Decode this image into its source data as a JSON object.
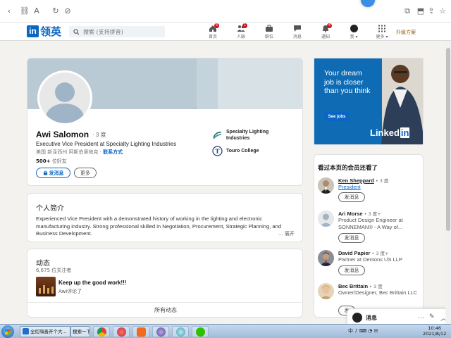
{
  "nav": {
    "logo": "领英",
    "search_placeholder": "搜索 (支持拼音)",
    "items": [
      {
        "label": "首页",
        "badge": "6"
      },
      {
        "label": "人脉",
        "badge": "1"
      },
      {
        "label": "职位",
        "badge": ""
      },
      {
        "label": "消息",
        "badge": ""
      },
      {
        "label": "通知",
        "badge": "4"
      },
      {
        "label": "我 ▾",
        "badge": ""
      },
      {
        "label": "更多 ▾",
        "badge": ""
      }
    ],
    "upgrade": "升级方案"
  },
  "profile": {
    "name": "Awi Salomon",
    "degree": "· 3 度",
    "headline": "Executive Vice President at Specialty Lighting Industries",
    "location": "美国 新泽西州 阿斯伯里帕克 · ",
    "contact": "联系方式",
    "connections_count": "500+",
    "connections_label": " 位好友",
    "message_button": "发消息",
    "more_button": "更多",
    "orgs": [
      {
        "name": "Specialty Lighting Industries"
      },
      {
        "name": "Touro College"
      }
    ]
  },
  "about": {
    "title": "个人简介",
    "text": "Experienced Vice President with a demonstrated history of working in the lighting and electronic manufacturing industry. Strong professional skilled in Negotiation, Procurement, Strategic Planning, and Business Development.",
    "more": "... 展开"
  },
  "activity": {
    "title": "动态",
    "followers": "6,675 位关注者",
    "post_title": "Keep up the good work!!!",
    "post_sub": "Awi评论了",
    "all_link": "所有动态"
  },
  "ad": {
    "text": "Your dream job is closer than you think",
    "button": "See jobs",
    "logo_a": "Linked",
    "logo_b": "in"
  },
  "also_viewed": {
    "title": "看过本页的会员还看了",
    "people": [
      {
        "name": "Ken Sheppard",
        "degree": " • 3 度",
        "title": "President",
        "button": "发消息"
      },
      {
        "name": "Ari Morse",
        "degree": " • 3 度+",
        "title": "Product Design Engineer at SONNEMAN® - A Way of...",
        "button": "发消息"
      },
      {
        "name": "David Papier",
        "degree": " • 3 度+",
        "title": "Partner at Dentons US LLP",
        "button": "发消息"
      },
      {
        "name": "Bec Brittain",
        "degree": " • 3 度",
        "title": "Owner/Designer, Bec Brittain LLC",
        "button": "发"
      }
    ]
  },
  "messaging": {
    "label": "消息",
    "icons": [
      "…",
      "✎",
      "︿"
    ]
  },
  "taskbar": {
    "window1": "全红嗨善开个大...",
    "window2": "搜索一下",
    "tray": "中 ♪ ⌨ ◔ ✉",
    "time": "10:46",
    "date": "2021/8/12"
  }
}
